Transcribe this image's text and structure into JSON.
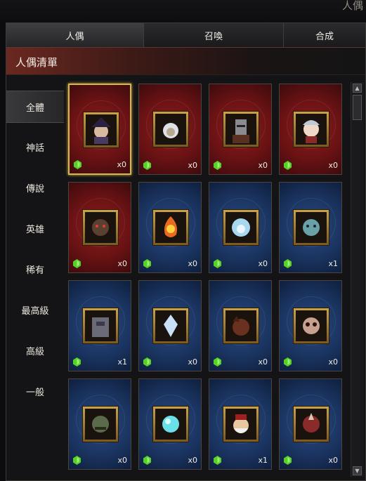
{
  "window": {
    "title": "人偶"
  },
  "tabs": [
    {
      "label": "人偶",
      "active": true
    },
    {
      "label": "召喚",
      "active": false
    },
    {
      "label": "合成",
      "active": false
    }
  ],
  "list_header": "人偶清單",
  "sidebar": {
    "items": [
      {
        "label": "全體",
        "active": true
      },
      {
        "label": "神話"
      },
      {
        "label": "傳說"
      },
      {
        "label": "英雄"
      },
      {
        "label": "稀有"
      },
      {
        "label": "最高級"
      },
      {
        "label": "高級"
      },
      {
        "label": "一般"
      }
    ]
  },
  "colors": {
    "red_card": "#7a1618",
    "blue_card": "#1b3562",
    "gold_frame": "#c9a349",
    "gem": "#57d12a",
    "selected_border": "#d9b64a"
  },
  "dolls": [
    {
      "frame": "red",
      "count": "x0",
      "selected": true,
      "icon": "witch-doll-icon"
    },
    {
      "frame": "red",
      "count": "x0",
      "icon": "white-haired-sage-doll-icon"
    },
    {
      "frame": "red",
      "count": "x0",
      "icon": "armored-knight-doll-icon"
    },
    {
      "frame": "red",
      "count": "x0",
      "icon": "pale-maiden-doll-icon"
    },
    {
      "frame": "red",
      "count": "x0",
      "icon": "dark-ogre-doll-icon"
    },
    {
      "frame": "blue",
      "count": "x0",
      "icon": "fire-spirit-doll-icon"
    },
    {
      "frame": "blue",
      "count": "x0",
      "icon": "ice-spirit-doll-icon"
    },
    {
      "frame": "blue",
      "count": "x1",
      "icon": "undead-ghoul-doll-icon"
    },
    {
      "frame": "blue",
      "count": "x1",
      "icon": "stone-golem-doll-icon"
    },
    {
      "frame": "blue",
      "count": "x0",
      "icon": "crystal-spirit-doll-icon"
    },
    {
      "frame": "blue",
      "count": "x0",
      "icon": "beast-doll-icon"
    },
    {
      "frame": "blue",
      "count": "x0",
      "icon": "skull-demon-doll-icon"
    },
    {
      "frame": "blue",
      "count": "x0",
      "icon": "orc-doll-icon"
    },
    {
      "frame": "blue",
      "count": "x0",
      "icon": "crystal-orb-doll-icon"
    },
    {
      "frame": "blue",
      "count": "x1",
      "icon": "dwarf-doll-icon"
    },
    {
      "frame": "blue",
      "count": "x0",
      "icon": "red-warrior-doll-icon"
    }
  ]
}
